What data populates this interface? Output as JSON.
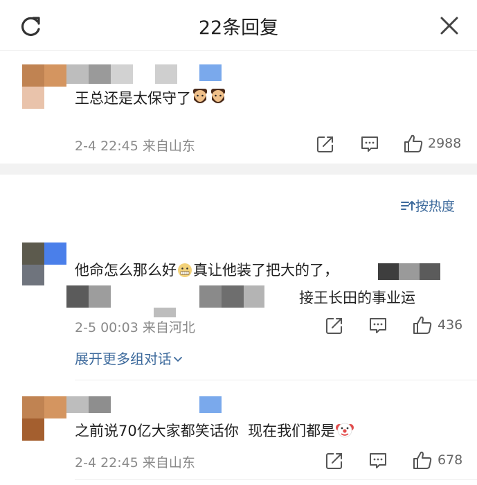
{
  "header": {
    "title": "22条回复"
  },
  "sort": {
    "label": "按热度"
  },
  "comments": [
    {
      "text": "王总还是太保守了",
      "time": "2-4 22:45",
      "location": "来自山东",
      "likes": "2988",
      "emojis": [
        "bearded-man-emoji",
        "bearded-man-emoji"
      ]
    },
    {
      "text_part1": "他命怎么那么好",
      "text_part2": "真让他装了把大的了，",
      "text_line2": "接王长田的事业运",
      "time": "2-5 00:03",
      "location": "来自河北",
      "likes": "436",
      "expand_label": "展开更多组对话",
      "emojis": [
        "grimace-emoji"
      ]
    },
    {
      "text": "之前说70亿大家都笑话你  现在我们都是",
      "time": "2-4 22:45",
      "location": "来自山东",
      "likes": "678",
      "emojis": [
        "clown-emoji"
      ]
    }
  ],
  "colors": {
    "link_blue": "#3d6a9c",
    "meta_gray": "#8a8a8a",
    "section_gray": "#f2f2f2"
  }
}
